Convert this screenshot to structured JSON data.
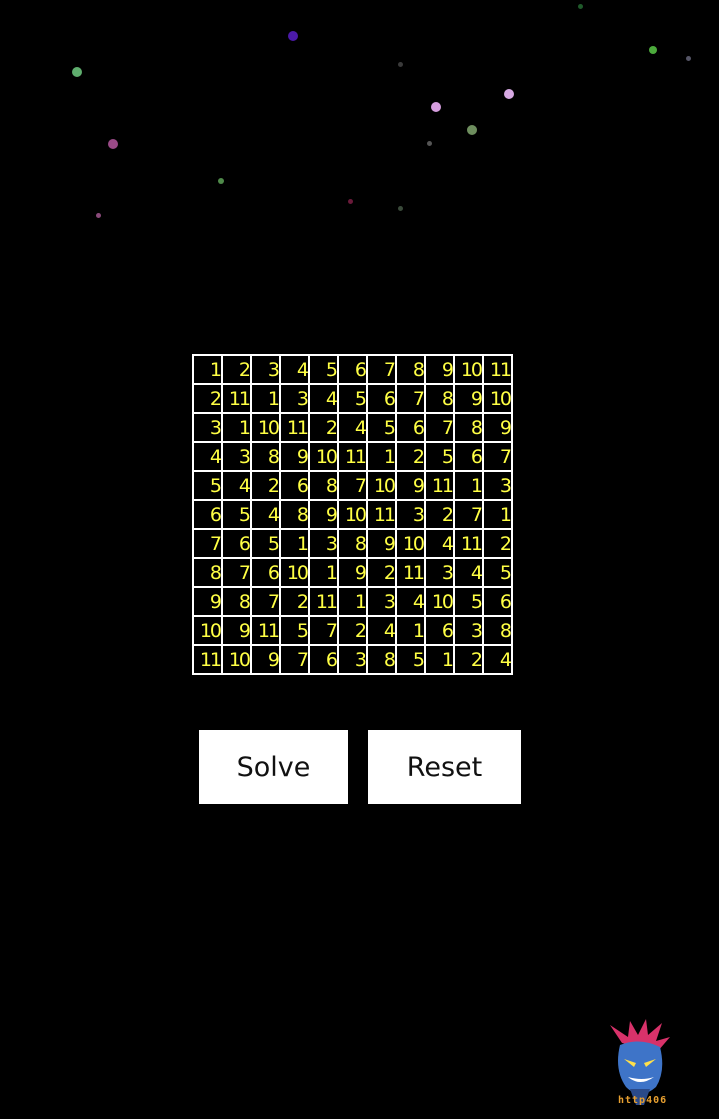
{
  "grid": [
    [
      "1",
      "2",
      "3",
      "4",
      "5",
      "6",
      "7",
      "8",
      "9",
      "10",
      "11"
    ],
    [
      "2",
      "11",
      "1",
      "3",
      "4",
      "5",
      "6",
      "7",
      "8",
      "9",
      "10"
    ],
    [
      "3",
      "1",
      "10",
      "11",
      "2",
      "4",
      "5",
      "6",
      "7",
      "8",
      "9"
    ],
    [
      "4",
      "3",
      "8",
      "9",
      "10",
      "11",
      "1",
      "2",
      "5",
      "6",
      "7"
    ],
    [
      "5",
      "4",
      "2",
      "6",
      "8",
      "7",
      "10",
      "9",
      "11",
      "1",
      "3"
    ],
    [
      "6",
      "5",
      "4",
      "8",
      "9",
      "10",
      "11",
      "3",
      "2",
      "7",
      "1"
    ],
    [
      "7",
      "6",
      "5",
      "1",
      "3",
      "8",
      "9",
      "10",
      "4",
      "11",
      "2"
    ],
    [
      "8",
      "7",
      "6",
      "10",
      "1",
      "9",
      "2",
      "11",
      "3",
      "4",
      "5"
    ],
    [
      "9",
      "8",
      "7",
      "2",
      "11",
      "1",
      "3",
      "4",
      "10",
      "5",
      "6"
    ],
    [
      "10",
      "9",
      "11",
      "5",
      "7",
      "2",
      "4",
      "1",
      "6",
      "3",
      "8"
    ],
    [
      "11",
      "10",
      "9",
      "7",
      "6",
      "3",
      "8",
      "5",
      "1",
      "2",
      "4"
    ]
  ],
  "buttons": {
    "solve_label": "Solve",
    "reset_label": "Reset"
  },
  "colors": {
    "background": "#000000",
    "cell_text": "#ffff44",
    "cell_border": "#ffffff",
    "button_bg": "#ffffff"
  },
  "mascot": {
    "icon": "blue-demon-mascot-icon",
    "caption": "http406"
  }
}
